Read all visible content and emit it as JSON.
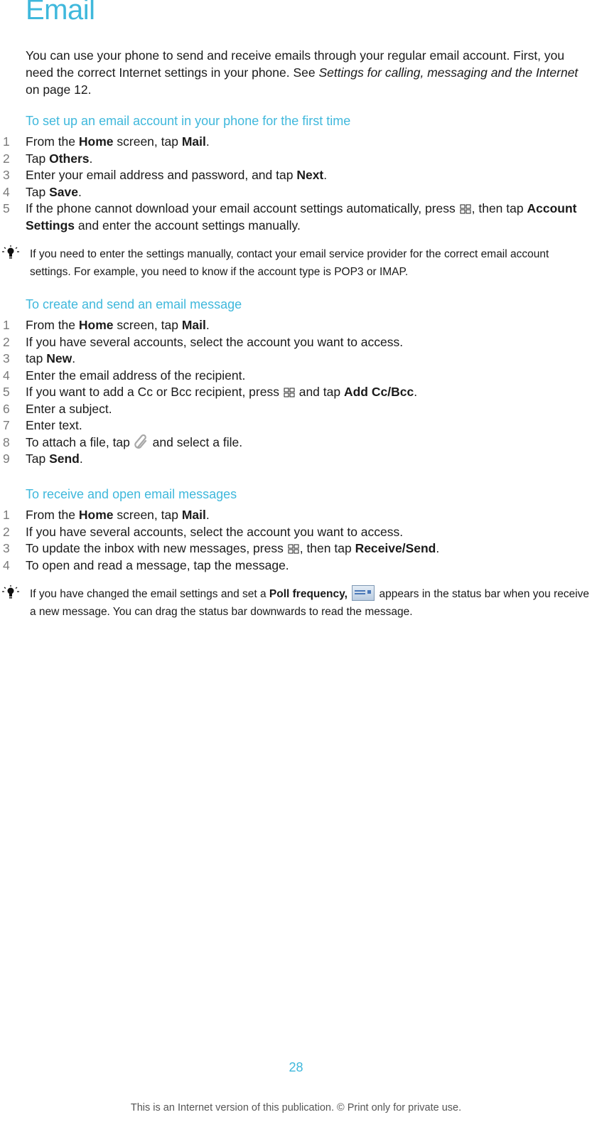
{
  "title": "Email",
  "intro": {
    "text_1": "You can use your phone to send and receive emails through your regular email account. First, you need the correct Internet settings in your phone. See ",
    "link": "Settings for calling, messaging and the Internet",
    "text_2": " on page 12."
  },
  "sections": [
    {
      "heading": "To set up an email account in your phone for the first time",
      "steps": [
        {
          "num": "1",
          "parts": [
            [
              "t",
              "From the "
            ],
            [
              "b",
              "Home"
            ],
            [
              "t",
              " screen, tap "
            ],
            [
              "b",
              "Mail"
            ],
            [
              "t",
              "."
            ]
          ]
        },
        {
          "num": "2",
          "parts": [
            [
              "t",
              "Tap "
            ],
            [
              "b",
              "Others"
            ],
            [
              "t",
              "."
            ]
          ]
        },
        {
          "num": "3",
          "parts": [
            [
              "t",
              "Enter your email address and password, and tap "
            ],
            [
              "b",
              "Next"
            ],
            [
              "t",
              "."
            ]
          ]
        },
        {
          "num": "4",
          "parts": [
            [
              "t",
              "Tap "
            ],
            [
              "b",
              "Save"
            ],
            [
              "t",
              "."
            ]
          ]
        },
        {
          "num": "5",
          "parts": [
            [
              "t",
              "If the phone cannot download your email account settings automatically, press "
            ],
            [
              "icon",
              "menu-icon"
            ],
            [
              "t",
              ", then tap "
            ],
            [
              "b",
              "Account Settings"
            ],
            [
              "t",
              " and enter the account settings manually."
            ]
          ]
        }
      ]
    },
    {
      "heading": "To create and send an email message",
      "steps": [
        {
          "num": "1",
          "parts": [
            [
              "t",
              "From the "
            ],
            [
              "b",
              "Home"
            ],
            [
              "t",
              " screen, tap "
            ],
            [
              "b",
              "Mail"
            ],
            [
              "t",
              "."
            ]
          ]
        },
        {
          "num": "2",
          "parts": [
            [
              "t",
              "If you have several accounts, select the account you want to access."
            ]
          ]
        },
        {
          "num": "3",
          "parts": [
            [
              "t",
              "tap "
            ],
            [
              "b",
              "New"
            ],
            [
              "t",
              "."
            ]
          ]
        },
        {
          "num": "4",
          "parts": [
            [
              "t",
              "Enter the email address of the recipient."
            ]
          ]
        },
        {
          "num": "5",
          "parts": [
            [
              "t",
              "If you want to add a Cc or Bcc recipient, press "
            ],
            [
              "icon",
              "menu-icon"
            ],
            [
              "t",
              " and tap "
            ],
            [
              "b",
              "Add Cc/Bcc"
            ],
            [
              "t",
              "."
            ]
          ]
        },
        {
          "num": "6",
          "parts": [
            [
              "t",
              "Enter a subject."
            ]
          ]
        },
        {
          "num": "7",
          "parts": [
            [
              "t",
              "Enter text."
            ]
          ]
        },
        {
          "num": "8",
          "parts": [
            [
              "t",
              "To attach a file, tap "
            ],
            [
              "icon",
              "paperclip-icon"
            ],
            [
              "t",
              " and select a file."
            ]
          ]
        },
        {
          "num": "9",
          "parts": [
            [
              "t",
              "Tap "
            ],
            [
              "b",
              "Send"
            ],
            [
              "t",
              "."
            ]
          ]
        }
      ]
    },
    {
      "heading": "To receive and open email messages",
      "steps": [
        {
          "num": "1",
          "parts": [
            [
              "t",
              "From the "
            ],
            [
              "b",
              "Home"
            ],
            [
              "t",
              " screen, tap "
            ],
            [
              "b",
              "Mail"
            ],
            [
              "t",
              "."
            ]
          ]
        },
        {
          "num": "2",
          "parts": [
            [
              "t",
              "If you have several accounts, select the account you want to access."
            ]
          ]
        },
        {
          "num": "3",
          "parts": [
            [
              "t",
              "To update the inbox with new messages, press "
            ],
            [
              "icon",
              "menu-icon"
            ],
            [
              "t",
              ", then tap "
            ],
            [
              "b",
              "Receive/Send"
            ],
            [
              "t",
              "."
            ]
          ]
        },
        {
          "num": "4",
          "parts": [
            [
              "t",
              "To open and read a message, tap the message."
            ]
          ]
        }
      ]
    }
  ],
  "notes": [
    {
      "icon": "lightbulb-icon",
      "parts": [
        [
          "t",
          "If you need to enter the settings manually, contact your email service provider for the correct email account settings. For example, you need to know if the account type is POP3 or IMAP."
        ]
      ]
    },
    {
      "icon": "lightbulb-icon",
      "parts": [
        [
          "t",
          "If you have changed the email settings and set a "
        ],
        [
          "b",
          "Poll frequency,"
        ],
        [
          "t",
          " "
        ],
        [
          "icon",
          "new-email-status-icon"
        ],
        [
          "t",
          " appears in the status bar when you receive a new message. You can drag the status bar downwards to read the message."
        ]
      ]
    }
  ],
  "page_number": "28",
  "footer": "This is an Internet version of this publication. © Print only for private use.",
  "colors": {
    "accent": "#3fb8dc",
    "text": "#1a1a1a",
    "step_number": "#7a7a7a"
  }
}
